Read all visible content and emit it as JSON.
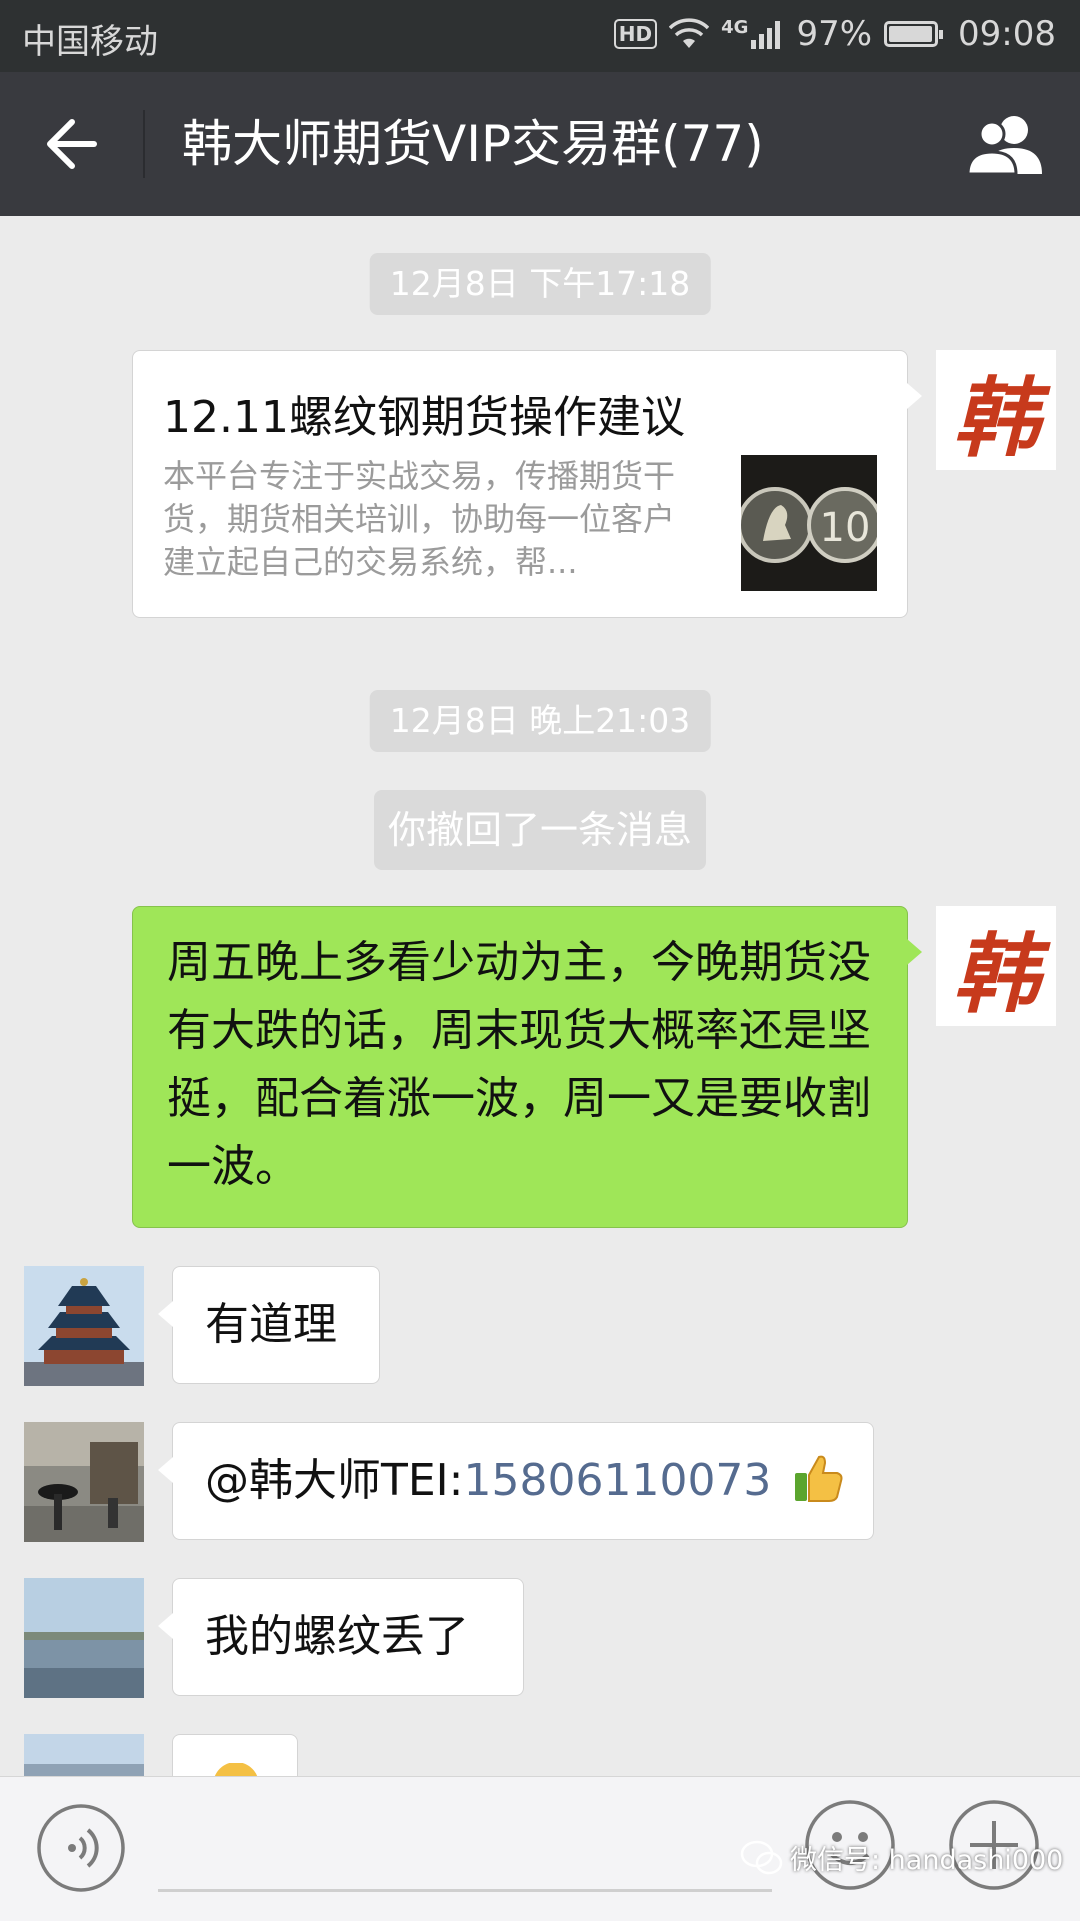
{
  "status_bar": {
    "carrier": "中国移动",
    "hd": "HD",
    "network": "4G",
    "battery": "97%",
    "battery_level": 0.97,
    "time": "09:08"
  },
  "header": {
    "title": "韩大师期货VIP交易群(77)"
  },
  "messages": {
    "ts1": "12月8日 下午17:18",
    "card": {
      "title": "12.11螺纹钢期货操作建议",
      "desc": "本平台专注于实战交易，传播期货干货，期货相关培训，协助每一位客户建立起自己的交易系统，帮..."
    },
    "ts2": "12月8日 晚上21:03",
    "recall": "你撤回了一条消息",
    "green_text": "周五晚上多看少动为主，今晚期货没有大跌的话，周末现货大概率还是坚挺，配合着涨一波，周一又是要收割一波。",
    "m1": "有道理",
    "m2_prefix": "@韩大师TEI:",
    "m2_phone": "15806110073",
    "m3": "我的螺纹丢了"
  },
  "avatar_han_char": "韩",
  "watermark": "微信号: handashi000",
  "colors": {
    "green_bubble": "#9fe658",
    "title_bar": "#393a3f",
    "background": "#ebebeb"
  }
}
